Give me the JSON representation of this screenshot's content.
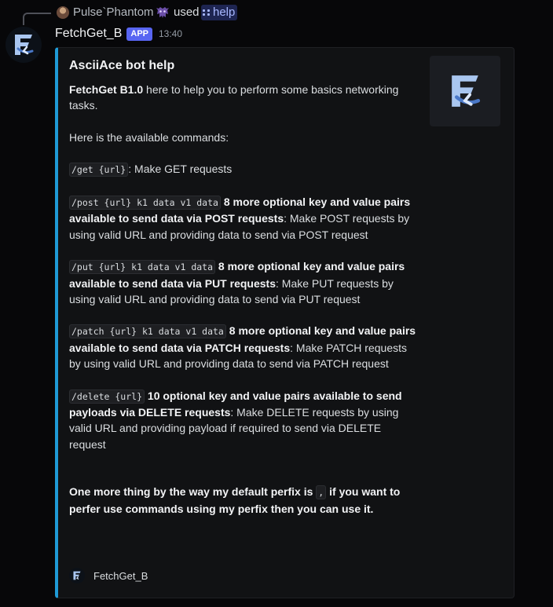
{
  "reply": {
    "username": "Pulse`Phantom",
    "used_text": "used",
    "command": "help"
  },
  "message": {
    "author": "FetchGet_B",
    "badge": "APP",
    "timestamp": "13:40"
  },
  "embed": {
    "title": "AsciiAce bot help",
    "intro_bold": "FetchGet B1.0",
    "intro_rest": " here to help you to perform some basics networking tasks.",
    "available_heading": "Here is the available commands:",
    "commands": [
      {
        "code": "/get {url}",
        "bold": "",
        "rest": ": Make GET requests"
      },
      {
        "code": "/post {url} k1 data v1 data",
        "bold": " 8 more optional key and value pairs available to send data via POST requests",
        "rest": ": Make POST requests by using valid URL and providing data to send via POST request"
      },
      {
        "code": "/put {url} k1 data v1 data",
        "bold": " 8 more optional key and value pairs available to send data via PUT requests",
        "rest": ": Make PUT requests by using valid URL and providing data to send via PUT request"
      },
      {
        "code": "/patch {url} k1 data v1 data",
        "bold": " 8 more optional key and value pairs available to send data via PATCH requests",
        "rest": ": Make PATCH requests by using valid URL and providing data to send via PATCH request"
      },
      {
        "code": "/delete {url}",
        "bold": " 10 optional key and value pairs available to send payloads via DELETE requests",
        "rest": ": Make DELETE requests by using valid URL and providing payload if required to send via DELETE request"
      }
    ],
    "closing_bold_1": "One more thing by the way my default perfix is ",
    "closing_code": ",",
    "closing_bold_2": " if you want to perfer use commands using my perfix then you can use it.",
    "footer": "FetchGet_B"
  },
  "colors": {
    "embed_border": "#1f9ad6",
    "app_badge": "#5865f2",
    "logo_light": "#a9c6f0",
    "logo_dark": "#4a78c8"
  }
}
